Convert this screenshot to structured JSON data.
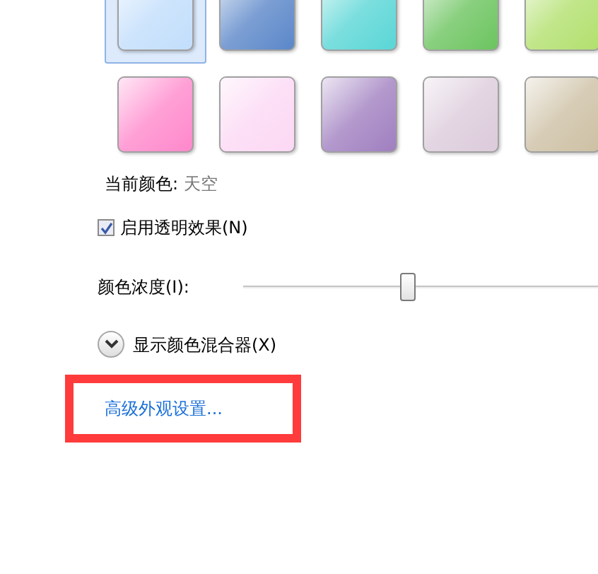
{
  "swatches": [
    {
      "color": "#c2defc",
      "selected": true
    },
    {
      "color": "#5b87c9",
      "selected": false
    },
    {
      "color": "#5ad6d6",
      "selected": false
    },
    {
      "color": "#6cc45f",
      "selected": false
    },
    {
      "color": "#b2e06e",
      "selected": false
    },
    {
      "color": "#ff88cc",
      "selected": false
    },
    {
      "color": "#fcd8f4",
      "selected": false
    },
    {
      "color": "#a07fc0",
      "selected": false
    },
    {
      "color": "#dccbdb",
      "selected": false
    },
    {
      "color": "#cdc0a4",
      "selected": false
    }
  ],
  "current_color": {
    "label": "当前颜色:",
    "value": "天空"
  },
  "transparency": {
    "label": "启用透明效果(N)",
    "checked": true
  },
  "intensity": {
    "label": "颜色浓度(I):",
    "level": 0.43
  },
  "mixer": {
    "label": "显示颜色混合器(X)",
    "expanded": false
  },
  "advanced_link": {
    "label": "高级外观设置...",
    "highlighted": true
  }
}
